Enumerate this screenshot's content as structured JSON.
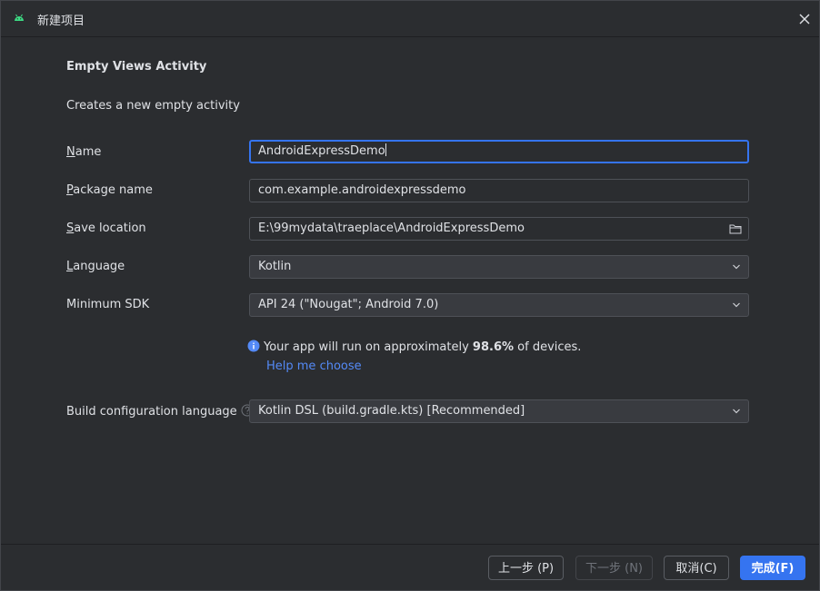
{
  "window": {
    "title": "新建项目",
    "app_icon": "android-icon"
  },
  "template": {
    "heading": "Empty Views Activity",
    "description": "Creates a new empty activity"
  },
  "form": {
    "name": {
      "label_mnemonic": "N",
      "label_rest": "ame",
      "value": "AndroidExpressDemo"
    },
    "package_name": {
      "label_mnemonic": "P",
      "label_rest": "ackage name",
      "value": "com.example.androidexpressdemo"
    },
    "save_location": {
      "label_mnemonic": "S",
      "label_rest": "ave location",
      "value": "E:\\99mydata\\traeplace\\AndroidExpressDemo",
      "icon": "folder-icon"
    },
    "language": {
      "label_mnemonic": "L",
      "label_rest": "anguage",
      "value": "Kotlin"
    },
    "minimum_sdk": {
      "label": "Minimum SDK",
      "value": "API 24 (\"Nougat\"; Android 7.0)"
    },
    "sdk_info": {
      "text_before": "Your app will run on approximately ",
      "percent": "98.6%",
      "text_after": " of devices.",
      "help_link": "Help me choose"
    },
    "build_config": {
      "label": "Build configuration language",
      "value": "Kotlin DSL (build.gradle.kts) [Recommended]"
    }
  },
  "footer": {
    "previous": "上一步 (P)",
    "next": "下一步 (N)",
    "cancel": "取消(C)",
    "finish": "完成(F)"
  },
  "colors": {
    "background": "#2b2d30",
    "accent": "#3574f0",
    "link": "#548af7",
    "android_green": "#3ddc84"
  }
}
